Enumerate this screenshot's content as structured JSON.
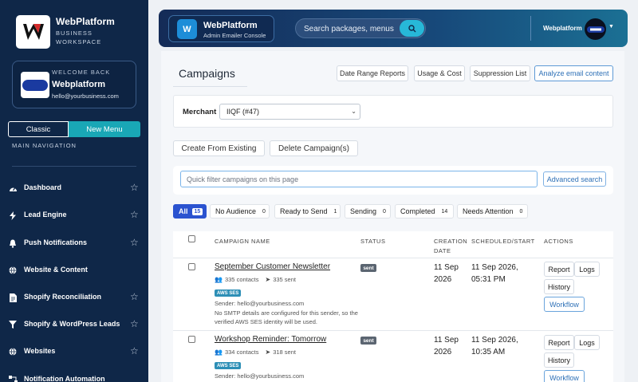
{
  "sidebar": {
    "brand_name": "WebPlatform",
    "brand_sub": "BUSINESS WORKSPACE",
    "welcome_label": "WELCOME BACK",
    "welcome_name": "Webplatform",
    "welcome_email": "hello@yourbusiness.com",
    "toggle_classic": "Classic",
    "toggle_new": "New Menu",
    "nav_heading": "MAIN NAVIGATION",
    "items": [
      {
        "label": "Dashboard",
        "icon": "speedometer-icon",
        "star": true
      },
      {
        "label": "Lead Engine",
        "icon": "bolt-icon",
        "star": true
      },
      {
        "label": "Push Notifications",
        "icon": "bell-icon",
        "star": true
      },
      {
        "label": "Website & Content",
        "icon": "globe-icon",
        "star": false
      },
      {
        "label": "Shopify Reconciliation",
        "icon": "document-icon",
        "star": true
      },
      {
        "label": "Shopify & WordPress Leads",
        "icon": "filter-icon",
        "star": true
      },
      {
        "label": "Websites",
        "icon": "globe-icon",
        "star": true
      },
      {
        "label": "Notification Automation",
        "icon": "flow-icon",
        "star": false
      }
    ]
  },
  "header": {
    "app_letter": "W",
    "app_name": "WebPlatform",
    "app_sub": "Admin Emailer Console",
    "search_placeholder": "Search packages, menus",
    "user_name": "Webplatform"
  },
  "main": {
    "title": "Campaigns",
    "top_buttons": [
      "Date Range Reports",
      "Usage & Cost",
      "Suppression List",
      "Analyze email content"
    ],
    "merchant_label": "Merchant",
    "merchant_value": "IIQF (#47)",
    "action_buttons": [
      "Create From Existing",
      "Delete Campaign(s)"
    ],
    "filter_placeholder": "Quick filter campaigns on this page",
    "advanced_search": "Advanced search",
    "filter_tabs": [
      {
        "label": "All",
        "count": "15",
        "active": true
      },
      {
        "label": "No Audience",
        "count": "0"
      },
      {
        "label": "Ready to Send",
        "count": "1"
      },
      {
        "label": "Sending",
        "count": "0"
      },
      {
        "label": "Completed",
        "count": "14"
      },
      {
        "label": "Needs Attention",
        "count": "0"
      }
    ],
    "table": {
      "headers": {
        "name": "CAMPAIGN NAME",
        "status": "STATUS",
        "created": "CREATION DATE",
        "scheduled": "SCHEDULED/START",
        "actions": "ACTIONS"
      },
      "rows": [
        {
          "name": "September Customer Newsletter",
          "contacts": "335 contacts",
          "sent": "335 sent",
          "provider": "AWS SES",
          "sender": "Sender: hello@yourbusiness.com",
          "note": "No SMTP details are configured for this sender, so the verified AWS SES identity will be used.",
          "status": "sent",
          "created": "11 Sep 2026",
          "scheduled": "11 Sep 2026, 05:31 PM",
          "buttons": [
            "Report",
            "Logs",
            "History",
            "Workflow"
          ]
        },
        {
          "name": "Workshop Reminder: Tomorrow",
          "contacts": "334 contacts",
          "sent": "318 sent",
          "provider": "AWS SES",
          "sender": "Sender: hello@yourbusiness.com",
          "status": "sent",
          "created": "11 Sep 2026",
          "scheduled": "11 Sep 2026, 10:35 AM",
          "buttons": [
            "Report",
            "Logs",
            "History",
            "Workflow"
          ]
        }
      ]
    }
  },
  "colors": {
    "sidebar_bg": "#0f2748",
    "accent_teal": "#19a7b6",
    "active_tab": "#2b53d0",
    "link_blue": "#2f71b7"
  }
}
